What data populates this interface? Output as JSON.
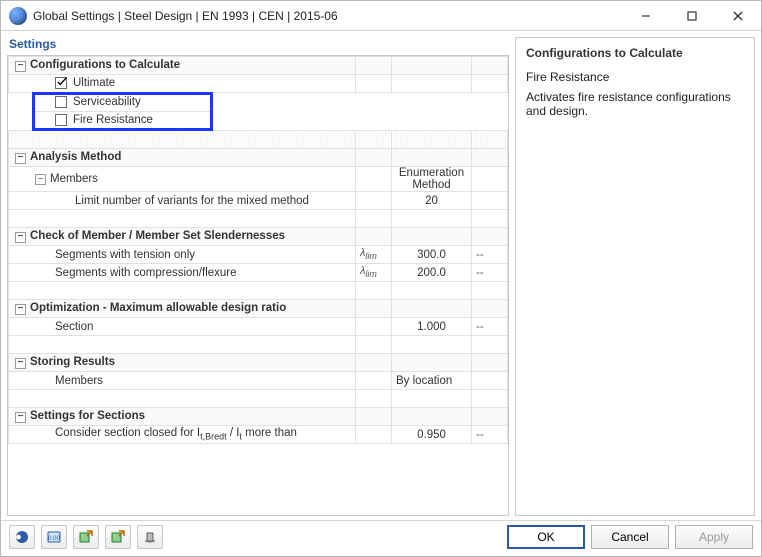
{
  "title": "Global Settings | Steel Design | EN 1993 | CEN | 2015-06",
  "left_panel_title": "Settings",
  "sections": {
    "configs": {
      "header": "Configurations to Calculate",
      "ultimate": "Ultimate",
      "serviceability": "Serviceability",
      "fire": "Fire Resistance"
    },
    "analysis": {
      "header": "Analysis Method",
      "members": "Members",
      "enum_col": "Enumeration Method",
      "limit_row": "Limit number of variants for the mixed method",
      "limit_val": "20"
    },
    "slender": {
      "header": "Check of Member / Member Set Slendernesses",
      "tension": "Segments with tension only",
      "flexure": "Segments with compression/flexure",
      "sym_html": "λ<span class=\"sub\">lim</span>",
      "val_tension": "300.0",
      "val_flexure": "200.0",
      "unit": "--"
    },
    "opt": {
      "header": "Optimization - Maximum allowable design ratio",
      "section": "Section",
      "val": "1.000",
      "unit": "--"
    },
    "storing": {
      "header": "Storing Results",
      "members": "Members",
      "val": "By location"
    },
    "sectset": {
      "header": "Settings for Sections",
      "closed_html": "Consider section closed for I<span class=\"sub\">t,Bredt</span> / I<span class=\"sub\">t</span> more than",
      "val": "0.950",
      "unit": "--"
    }
  },
  "right": {
    "title": "Configurations to Calculate",
    "sub": "Fire Resistance",
    "text": "Activates fire resistance configurations and design."
  },
  "buttons": {
    "ok": "OK",
    "cancel": "Cancel",
    "apply": "Apply"
  }
}
